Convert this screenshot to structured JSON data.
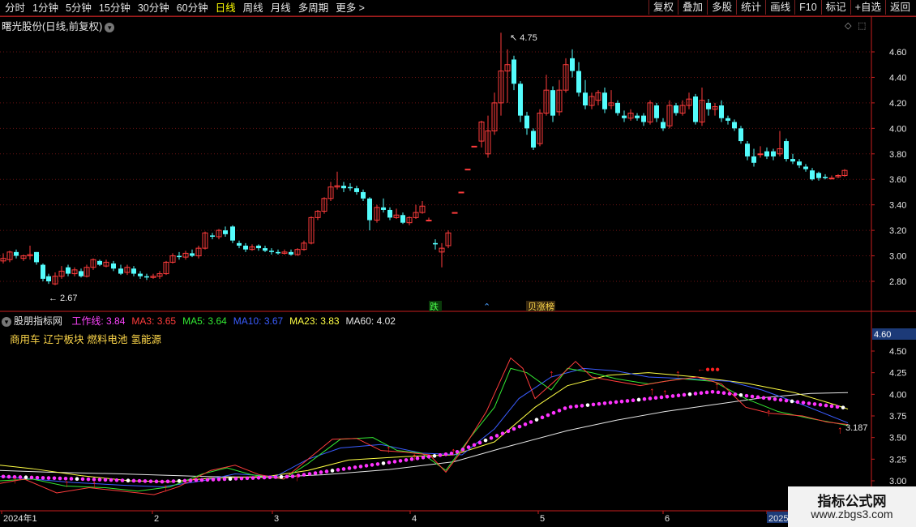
{
  "toolbar": {
    "periods": [
      "分时",
      "1分钟",
      "5分钟",
      "15分钟",
      "30分钟",
      "60分钟",
      "日线",
      "周线",
      "月线",
      "多周期",
      "更多 >"
    ],
    "active_period": "日线",
    "buttons": [
      "复权",
      "叠加",
      "多股",
      "统计",
      "画线",
      "F10",
      "标记",
      "+自选",
      "返回"
    ]
  },
  "main_chart": {
    "title": "曙光股份(日线,前复权)",
    "price_axis": [
      "4.60",
      "4.40",
      "4.20",
      "4.00",
      "3.80",
      "3.60",
      "3.40",
      "3.20",
      "3.00",
      "2.80"
    ],
    "high_label": "4.75",
    "low_label": "2.67",
    "markers": [
      "跌",
      "涨榜"
    ],
    "colors": {
      "up": "#ff3c3c",
      "down": "#54fcfc",
      "grid": "#6a1212",
      "axis": "#c81e1e"
    }
  },
  "indicator": {
    "name": "股朋指标网",
    "values": [
      {
        "label": "工作线: 3.84",
        "color": "#ff44ff"
      },
      {
        "label": "MA3: 3.65",
        "color": "#ff3c3c"
      },
      {
        "label": "MA5: 3.64",
        "color": "#33e833"
      },
      {
        "label": "MA10: 3.67",
        "color": "#3a5cff"
      },
      {
        "label": "MA23: 3.83",
        "color": "#ffff44"
      },
      {
        "label": "MA60: 4.02",
        "color": "#e6e6e6"
      }
    ],
    "concepts": [
      "商用车",
      "辽宁板块",
      "燃料电池",
      "氢能源"
    ],
    "axis": [
      "4.50",
      "4.25",
      "4.00",
      "3.75",
      "3.50",
      "3.25",
      "3.00"
    ],
    "current_value": "4.60",
    "end_label": "3.187"
  },
  "time_axis": [
    "2024年1",
    "2",
    "3",
    "4",
    "5",
    "6",
    "2025"
  ],
  "watermark": {
    "line1": "指标公式网",
    "line2": "www.zbgs3.com"
  }
}
